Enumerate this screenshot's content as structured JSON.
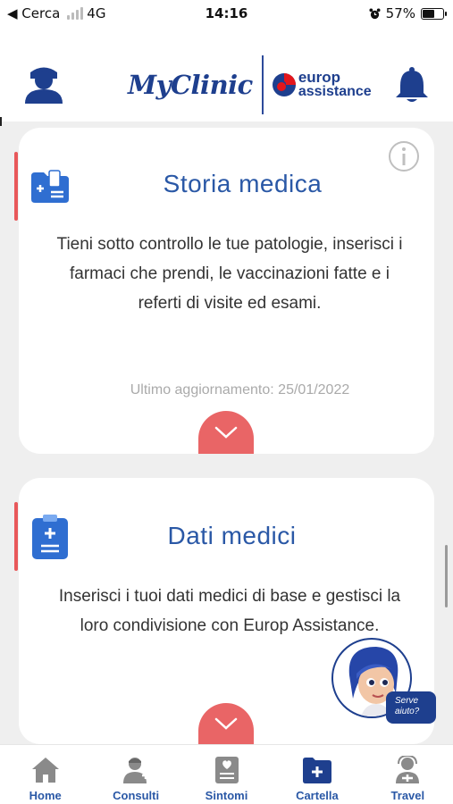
{
  "status_bar": {
    "back_label": "◀ Cerca",
    "network": "4G",
    "time": "14:16",
    "battery": "57%",
    "battery_level": 0.57
  },
  "header": {
    "logo_text": "MyClinic",
    "partner_line1": "europ",
    "partner_line2": "assistance"
  },
  "cards": [
    {
      "title": "Storia medica",
      "description": "Tieni sotto controllo le tue patologie, inserisci i farmaci che prendi, le vaccinazioni fatte e i referti di visite ed esami.",
      "update_label": "Ultimo aggiornamento:",
      "update_date": "25/01/2022"
    },
    {
      "title": "Dati medici",
      "description": "Inserisci i tuoi dati medici di base e gestisci la loro condivisione con Europ Assistance."
    }
  ],
  "assistant": {
    "help_line1": "Serve",
    "help_line2": "aiuto?"
  },
  "nav": [
    {
      "label": "Home",
      "icon": "home-icon"
    },
    {
      "label": "Consulti",
      "icon": "doctor-icon"
    },
    {
      "label": "Sintomi",
      "icon": "symptoms-icon"
    },
    {
      "label": "Cartella",
      "icon": "medical-folder-icon",
      "active": true
    },
    {
      "label": "Travel",
      "icon": "travel-doctor-icon"
    }
  ],
  "colors": {
    "brand_blue": "#2a58a6",
    "accent_red": "#e96566",
    "background": "#efefef"
  }
}
